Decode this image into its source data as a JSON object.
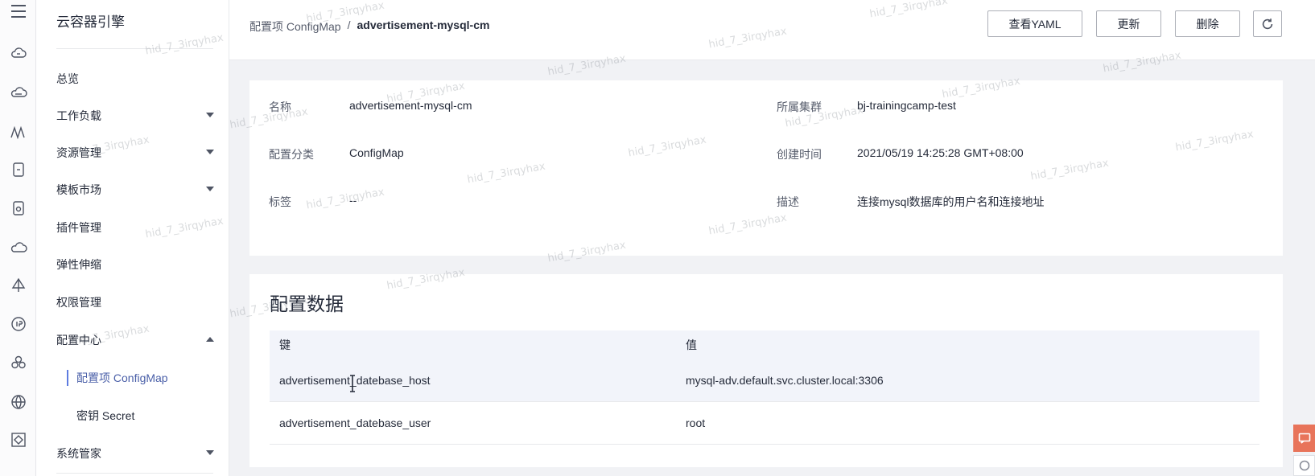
{
  "sidebar": {
    "brand": "云容器引擎",
    "items": [
      {
        "label": "总览"
      },
      {
        "label": "工作负载"
      },
      {
        "label": "资源管理"
      },
      {
        "label": "模板市场"
      },
      {
        "label": "插件管理"
      },
      {
        "label": "弹性伸缩"
      },
      {
        "label": "权限管理"
      },
      {
        "label": "配置中心"
      },
      {
        "label": "配置项 ConfigMap"
      },
      {
        "label": "密钥 Secret"
      },
      {
        "label": "系统管家"
      }
    ]
  },
  "header": {
    "breadcrumb_parent": "配置项 ConfigMap",
    "breadcrumb_sep": "/",
    "breadcrumb_current": "advertisement-mysql-cm",
    "view_yaml": "查看YAML",
    "update": "更新",
    "delete": "删除"
  },
  "info": {
    "name_label": "名称",
    "name_value": "advertisement-mysql-cm",
    "cluster_label": "所属集群",
    "cluster_value": "bj-trainingcamp-test",
    "type_label": "配置分类",
    "type_value": "ConfigMap",
    "created_label": "创建时间",
    "created_value": "2021/05/19 14:25:28 GMT+08:00",
    "tags_label": "标签",
    "tags_value": "--",
    "desc_label": "描述",
    "desc_value": "连接mysql数据库的用户名和连接地址"
  },
  "config": {
    "title": "配置数据",
    "col_key": "键",
    "col_value": "值",
    "rows": [
      {
        "key": "advertisement_datebase_host",
        "value": "mysql-adv.default.svc.cluster.local:3306"
      },
      {
        "key": "advertisement_datebase_user",
        "value": "root"
      }
    ]
  },
  "watermark": "hid_7_3irqyhax"
}
